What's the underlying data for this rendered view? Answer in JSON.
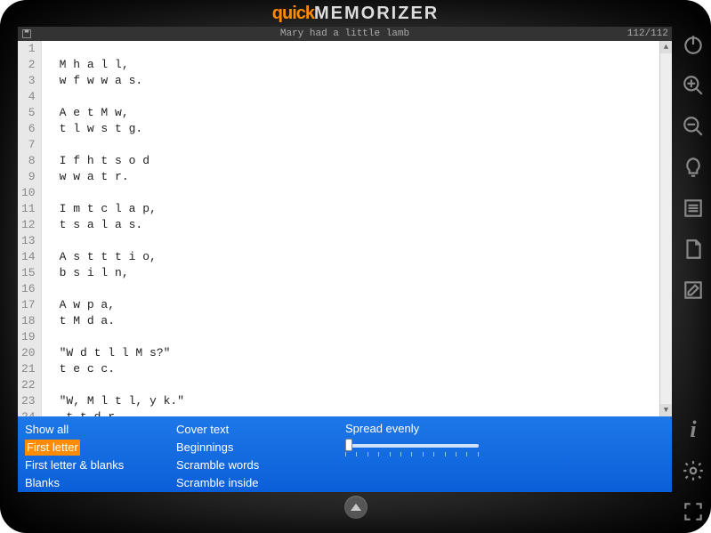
{
  "app": {
    "title_quick": "quick",
    "title_mem": "MEMORIZER"
  },
  "header": {
    "doc_title": "Mary had a little lamb",
    "counter": "112/112"
  },
  "editor": {
    "lines": [
      "",
      "M h a l l,",
      "w f w w a s.",
      "",
      "A e t M w,",
      "t l w s t g.",
      "",
      "I f h t s o d",
      "w w a t r.",
      "",
      "I m t c l a p,",
      "t s a l a s.",
      "",
      "A s t t t i o,",
      "b s i l n,",
      "",
      "A w p a,",
      "t M d a.",
      "",
      "\"W d t l l M s?\"",
      "t e c c.",
      "",
      "\"W, M l t l, y k.\"",
      " t t d r."
    ]
  },
  "filters": {
    "col1": [
      {
        "label": "Show all",
        "active": false
      },
      {
        "label": "First letter",
        "active": true
      },
      {
        "label": "First letter & blanks",
        "active": false
      },
      {
        "label": "Blanks",
        "active": false
      }
    ],
    "col2": [
      {
        "label": "Cover text",
        "active": false
      },
      {
        "label": "Beginnings",
        "active": false
      },
      {
        "label": "Scramble words",
        "active": false
      },
      {
        "label": "Scramble inside",
        "active": false
      }
    ]
  },
  "slider": {
    "label": "Spread evenly"
  },
  "rail": {
    "power": "power-icon",
    "zoom_in": "zoom-in-icon",
    "zoom_out": "zoom-out-icon",
    "bulb": "lightbulb-icon",
    "list": "list-icon",
    "page": "page-icon",
    "edit": "edit-icon",
    "info": "info-icon",
    "gear": "gear-icon",
    "fullscreen": "fullscreen-icon"
  }
}
